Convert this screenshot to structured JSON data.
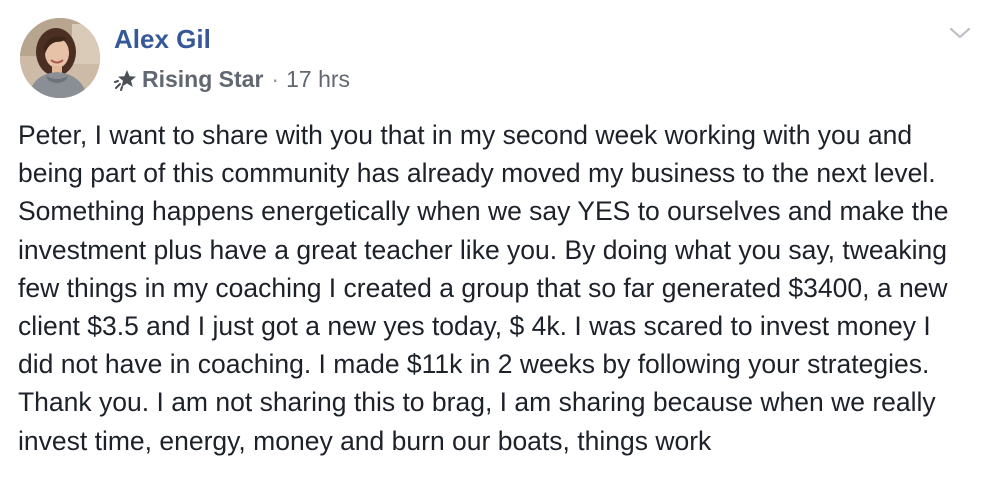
{
  "post": {
    "author": {
      "name": "Alex Gil",
      "avatar": "avatar-photo"
    },
    "badge": {
      "icon": "rising-star-icon",
      "label": "Rising Star"
    },
    "separator": "·",
    "timestamp": "17 hrs",
    "menu_icon": "chevron-down-icon",
    "body": "Peter, I want to share with you that in my second week working with you and being part of this community has already moved my business to the next level. Something happens energetically when we say YES to ourselves and make the investment plus have a great teacher like you. By doing what you say, tweaking few things in my coaching I created a group that so far generated $3400, a new client $3.5 and I just got a new yes today, $ 4k. I was scared to invest money I did not have in coaching. I made $11k in 2 weeks by following your strategies. Thank you. I am not sharing this to brag, I am sharing because when we really invest time, energy, money and burn our boats, things work"
  },
  "colors": {
    "link_blue": "#365899",
    "meta_gray": "#616770",
    "text": "#1d2129"
  }
}
